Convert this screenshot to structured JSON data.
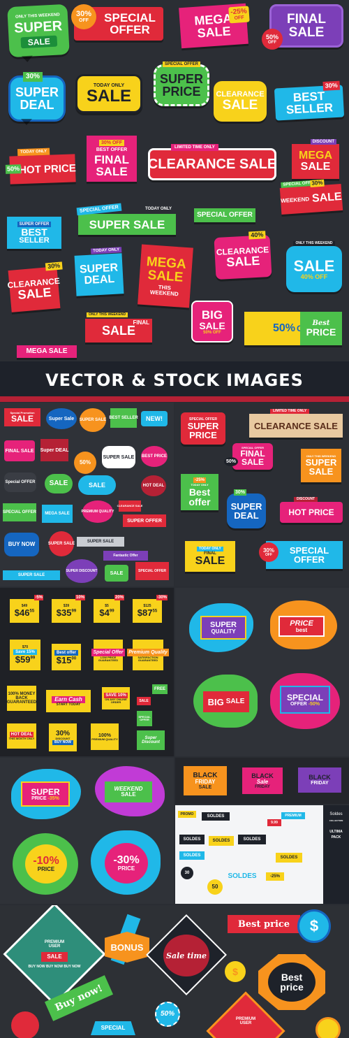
{
  "colors": {
    "bg_dark": "#2a2d33",
    "banner_bg": "#1e222a",
    "accent_red": "#e02a3a",
    "accent_yellow": "#f8d21b",
    "accent_cyan": "#20b8e8",
    "accent_green": "#4cc04b",
    "accent_magenta": "#e6227a",
    "accent_purple": "#7c3fb8",
    "accent_orange": "#f7931e"
  },
  "banner": {
    "text": "VECTOR & STOCK IMAGES"
  },
  "top_labels": [
    {
      "t1": "ONLY THIS WEEKEND",
      "t2": "SUPER",
      "t3": "SALE"
    },
    {
      "t1": "30%",
      "t2": "OFF",
      "t3": "SPECIAL",
      "t4": "OFFER"
    },
    {
      "t1": "MEGA",
      "t2": "SALE",
      "t3": "-25%",
      "t4": "OFF"
    },
    {
      "t1": "FINAL",
      "t2": "SALE",
      "t3": "50%",
      "t4": "OFF"
    },
    {
      "t1": "30%",
      "t2": "SUPER",
      "t3": "DEAL"
    },
    {
      "t1": "TODAY ONLY",
      "t2": "SALE"
    },
    {
      "t1": "SPECIAL OFFER",
      "t2": "SUPER",
      "t3": "PRICE"
    },
    {
      "t1": "CLEARANCE",
      "t2": "SALE"
    },
    {
      "t1": "30%",
      "t2": "BEST",
      "t3": "SELLER"
    },
    {
      "t1": "TODAY ONLY",
      "t2": "50%",
      "t3": "HOT PRICE"
    },
    {
      "t1": "30% OFF",
      "t2": "BEST OFFER",
      "t3": "FINAL",
      "t4": "SALE"
    },
    {
      "t1": "LIMITED TIME ONLY",
      "t2": "CLEARANCE SALE"
    },
    {
      "t1": "DISCOUNT",
      "t2": "MEGA",
      "t3": "SALE"
    },
    {
      "t1": "SUPER OFFER",
      "t2": "BEST",
      "t3": "SELLER"
    },
    {
      "t1": "SPECIAL OFFER",
      "t2": "TODAY ONLY",
      "t3": "SUPER SALE"
    },
    {
      "t1": "SPECIAL OFFER"
    },
    {
      "t1": "SPECIAL OFFER",
      "t2": "30%",
      "t3": "WEEKEND",
      "t4": "SALE"
    },
    {
      "t1": "30%",
      "t2": "CLEARANCE",
      "t3": "SALE"
    },
    {
      "t1": "TODAY ONLY",
      "t2": "SUPER",
      "t3": "DEAL"
    },
    {
      "t1": "MEGA",
      "t2": "SALE",
      "t3": "THIS",
      "t4": "WEEKEND"
    },
    {
      "t1": "40%",
      "t2": "CLEARANCE",
      "t3": "SALE"
    },
    {
      "t1": "ONLY THIS WEEKEND",
      "t2": "SALE",
      "t3": "40% OFF"
    },
    {
      "t1": "ONLY THIS WEEKEND",
      "t2": "FINAL",
      "t3": "SALE"
    },
    {
      "t1": "BIG",
      "t2": "SALE",
      "t3": "50% OFF"
    },
    {
      "t1": "50%",
      "t2": "OFF",
      "t3": "Best",
      "t4": "PRICE"
    },
    {
      "t1": "MEGA SALE"
    }
  ],
  "panel2_left": [
    {
      "t": "Special Promotion"
    },
    {
      "t": "SALE"
    },
    {
      "t": "Super Sale"
    },
    {
      "t": "SUPER SALE"
    },
    {
      "t": "BEST SELLER"
    },
    {
      "t": "NEW!"
    },
    {
      "t": "FINAL SALE"
    },
    {
      "t": "Super DEAL"
    },
    {
      "t": "BEST PRICE"
    },
    {
      "t": "SUPER SALE"
    },
    {
      "t": "50%"
    },
    {
      "t": "Special OFFER"
    },
    {
      "t": "SALE"
    },
    {
      "t": "SALE"
    },
    {
      "t": "HOT DEAL"
    },
    {
      "t": "SPECIAL OFFER"
    },
    {
      "t": "MEGA SALE"
    },
    {
      "t": "PREMIUM QUALITY"
    },
    {
      "t": "CLEARANCE SALE"
    },
    {
      "t": "SUPER OFFER"
    },
    {
      "t": "BUY NOW"
    },
    {
      "t": "SUPER SALE"
    },
    {
      "t": "SUPER SALE"
    },
    {
      "t": "Fantastic Offer"
    },
    {
      "t": "SUPER SALE"
    },
    {
      "t": "SUPER DISCOUNT"
    },
    {
      "t": "SALE"
    },
    {
      "t": "SPECIAL OFFER"
    }
  ],
  "panel2_right": [
    {
      "t1": "SPECIAL OFFER",
      "t2": "SUPER",
      "t3": "PRICE"
    },
    {
      "t1": "LIMITED TIME ONLY",
      "t2": "CLEARANCE SALE"
    },
    {
      "t1": "SPECIAL OFFER",
      "t2": "FINAL",
      "t3": "SALE",
      "t4": "50%"
    },
    {
      "t1": "ONLY THIS WEEKEND",
      "t2": "SUPER",
      "t3": "SALE"
    },
    {
      "t1": "-25%",
      "t2": "TODAY ONLY",
      "t3": "Best",
      "t4": "offer"
    },
    {
      "t1": "30%",
      "t2": "SUPER",
      "t3": "DEAL"
    },
    {
      "t1": "DISCOUNT",
      "t2": "HOT PRICE"
    },
    {
      "t1": "TODAY ONLY",
      "t2": "FINAL",
      "t3": "SALE"
    },
    {
      "t1": "30%",
      "t2": "OFF",
      "t3": "SPECIAL",
      "t4": "OFFER"
    }
  ],
  "prices": [
    {
      "old": "$49",
      "pct": "-5%",
      "price": "$46",
      "cents": "55"
    },
    {
      "old": "$39",
      "pct": "10%",
      "price": "$35",
      "cents": "99"
    },
    {
      "old": "$5",
      "pct": "20%",
      "price": "$4",
      "cents": "99"
    },
    {
      "old": "$125",
      "pct": "-30%",
      "price": "$87",
      "cents": "55"
    },
    {
      "old": "$70",
      "t": "Save 15%",
      "price": "$59",
      "cents": "99"
    },
    {
      "t": "Best offer",
      "price": "$15",
      "cents": "00"
    },
    {
      "t": "Special Offer",
      "t2": "LOW PRICE GUARANTEED"
    },
    {
      "t": "Premium Quality",
      "t2": "SATISFACTION GUARANTEED"
    },
    {
      "t": "100% MONEY BACK GUARANTEED"
    },
    {
      "t": "Earn Cash",
      "t2": "START TODAY"
    },
    {
      "t": "SAVE 10%",
      "t2": "ON ANY ONLINE ORDER"
    },
    {
      "t": "FREE"
    },
    {
      "t": "SALE"
    },
    {
      "t": "SPECIAL OFFER"
    },
    {
      "t": "HOT DEAL",
      "t2": "THIS MONTH ONLY"
    },
    {
      "t": "30%",
      "t2": "DISCOUNT",
      "t3": "BUY NOW"
    },
    {
      "t": "100%",
      "t2": "PREMIUM QUALITY"
    },
    {
      "t": "Super Discount"
    }
  ],
  "blobs1": [
    {
      "t1": "SUPER",
      "t2": "QUALITY"
    },
    {
      "t1": "PRICE",
      "t2": "best"
    },
    {
      "t1": "BIG",
      "t2": "SALE"
    },
    {
      "t1": "SPECIAL",
      "t2": "OFFER",
      "t3": "-50%"
    }
  ],
  "blobs2": [
    {
      "t1": "SUPER",
      "t2": "PRICE",
      "t3": "-35%"
    },
    {
      "t1": "WEEKEND",
      "t2": "SALE"
    },
    {
      "t1": "-10%",
      "t2": "PRICE"
    },
    {
      "t1": "-30%",
      "t2": "PRICE"
    }
  ],
  "black_friday": [
    {
      "t1": "BLACK",
      "t2": "FRIDAY",
      "t3": "SALE"
    },
    {
      "t1": "BLACK",
      "t2": "Sale",
      "t3": "FRIDAY"
    },
    {
      "t1": "BLACK",
      "t2": "FRIDAY"
    }
  ],
  "soldes": {
    "words": [
      "PROMO",
      "SOLDES",
      "PREMIUM",
      "SOLDES",
      "SOLDES",
      "SOLDES",
      "SOLDES",
      "SOLDES",
      "SOLDES",
      "30",
      "50",
      "-25%",
      "9.99"
    ],
    "side": [
      "Soldes",
      "COLLECTION",
      "ULTIMA",
      "PACK"
    ]
  },
  "bottom": {
    "premium": {
      "t1": "PREMIUM",
      "t2": "USER",
      "t3": "SALE",
      "t4": "BUY NOW BUY NOW BUY NOW"
    },
    "bonus": "BONUS",
    "sale_time": "Sale time",
    "best_price": "Best price",
    "dollar": "$",
    "buy_now": "Buy now!",
    "best_price2": {
      "t1": "Best",
      "t2": "price"
    },
    "fifty": "50%",
    "special": "SPECIAL",
    "premium2": {
      "t1": "PREMIUM",
      "t2": "USER"
    }
  }
}
